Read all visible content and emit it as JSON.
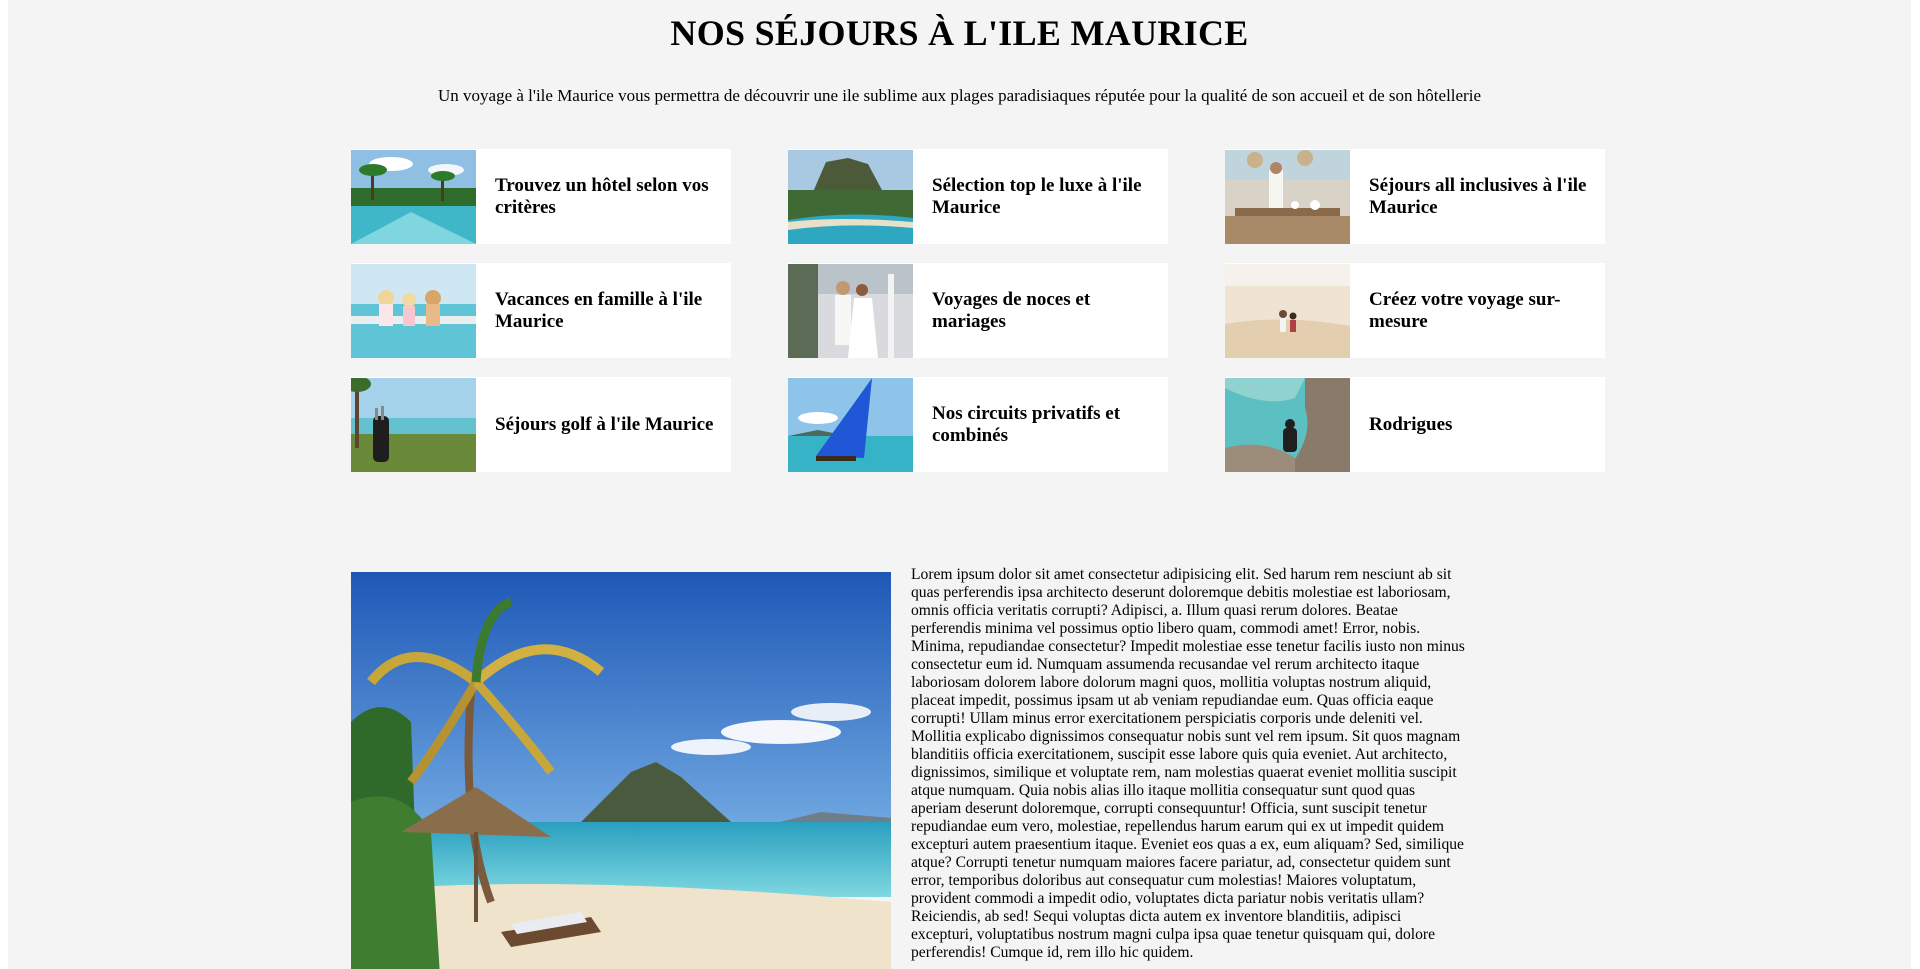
{
  "page": {
    "title": "NOS SÉJOURS À L'ILE MAURICE",
    "intro": "Un voyage à l'ile Maurice vous permettra de découvrir une ile sublime aux plages paradisiaques réputée pour la qualité de son accueil et de son hôtellerie"
  },
  "cards": [
    {
      "label": "Trouvez un hôtel selon vos critères",
      "image": "pool-palms-photo"
    },
    {
      "label": "Sélection top le luxe à l'ile Maurice",
      "image": "le-morne-aerial-photo"
    },
    {
      "label": "Séjours all inclusives à l'ile Maurice",
      "image": "restaurant-waiter-photo"
    },
    {
      "label": "Vacances en famille à l'ile Maurice",
      "image": "children-pool-photo"
    },
    {
      "label": "Voyages de noces et mariages",
      "image": "wedding-couple-photo"
    },
    {
      "label": "Créez votre voyage sur-mesure",
      "image": "beach-couple-photo"
    },
    {
      "label": "Séjours golf à l'ile Maurice",
      "image": "golf-bag-photo"
    },
    {
      "label": "Nos circuits privatifs et combinés",
      "image": "blue-sail-pirogue-photo"
    },
    {
      "label": "Rodrigues",
      "image": "rocky-coast-photo"
    }
  ],
  "feature": {
    "image": "palm-beach-umbrella-photo",
    "text": "Lorem ipsum dolor sit amet consectetur adipisicing elit. Sed harum rem nesciunt ab sit quas perferendis ipsa architecto deserunt doloremque debitis molestiae est laboriosam, omnis officia veritatis corrupti? Adipisci, a. Illum quasi rerum dolores. Beatae perferendis minima vel possimus optio libero quam, commodi amet! Error, nobis. Minima, repudiandae consectetur? Impedit molestiae esse tenetur facilis iusto non minus consectetur eum id. Numquam assumenda recusandae vel rerum architecto itaque laboriosam dolorem labore dolorum magni quos, mollitia voluptas nostrum aliquid, placeat impedit, possimus ipsam ut ab veniam repudiandae eum. Quas officia eaque corrupti! Ullam minus error exercitationem perspiciatis corporis unde deleniti vel. Mollitia explicabo dignissimos consequatur nobis sunt vel rem ipsum. Sit quos magnam blanditiis officia exercitationem, suscipit esse labore quis quia eveniet. Aut architecto, dignissimos, similique et voluptate rem, nam molestias quaerat eveniet mollitia suscipit atque numquam. Quia nobis alias illo itaque mollitia consequatur sunt quod quas aperiam deserunt doloremque, corrupti consequuntur! Officia, sunt suscipit tenetur repudiandae eum vero, molestiae, repellendus harum earum qui ex ut impedit quidem excepturi autem praesentium itaque. Eveniet eos quas a ex, eum aliquam? Sed, similique atque? Corrupti tenetur numquam maiores facere pariatur, ad, consectetur quidem sunt error, temporibus doloribus aut consequatur cum molestias! Maiores voluptatum, provident commodi a impedit odio, voluptates dicta pariatur nobis veritatis ullam? Reiciendis, ab sed! Sequi voluptas dicta autem ex inventore blanditiis, adipisci excepturi, voluptatibus nostrum magni culpa ipsa quae tenetur quisquam qui, dolore perferendis! Cumque id, rem illo hic quidem."
  },
  "colors": {
    "page_background": "#f4f4f4",
    "card_background": "#ffffff",
    "text": "#000000"
  }
}
